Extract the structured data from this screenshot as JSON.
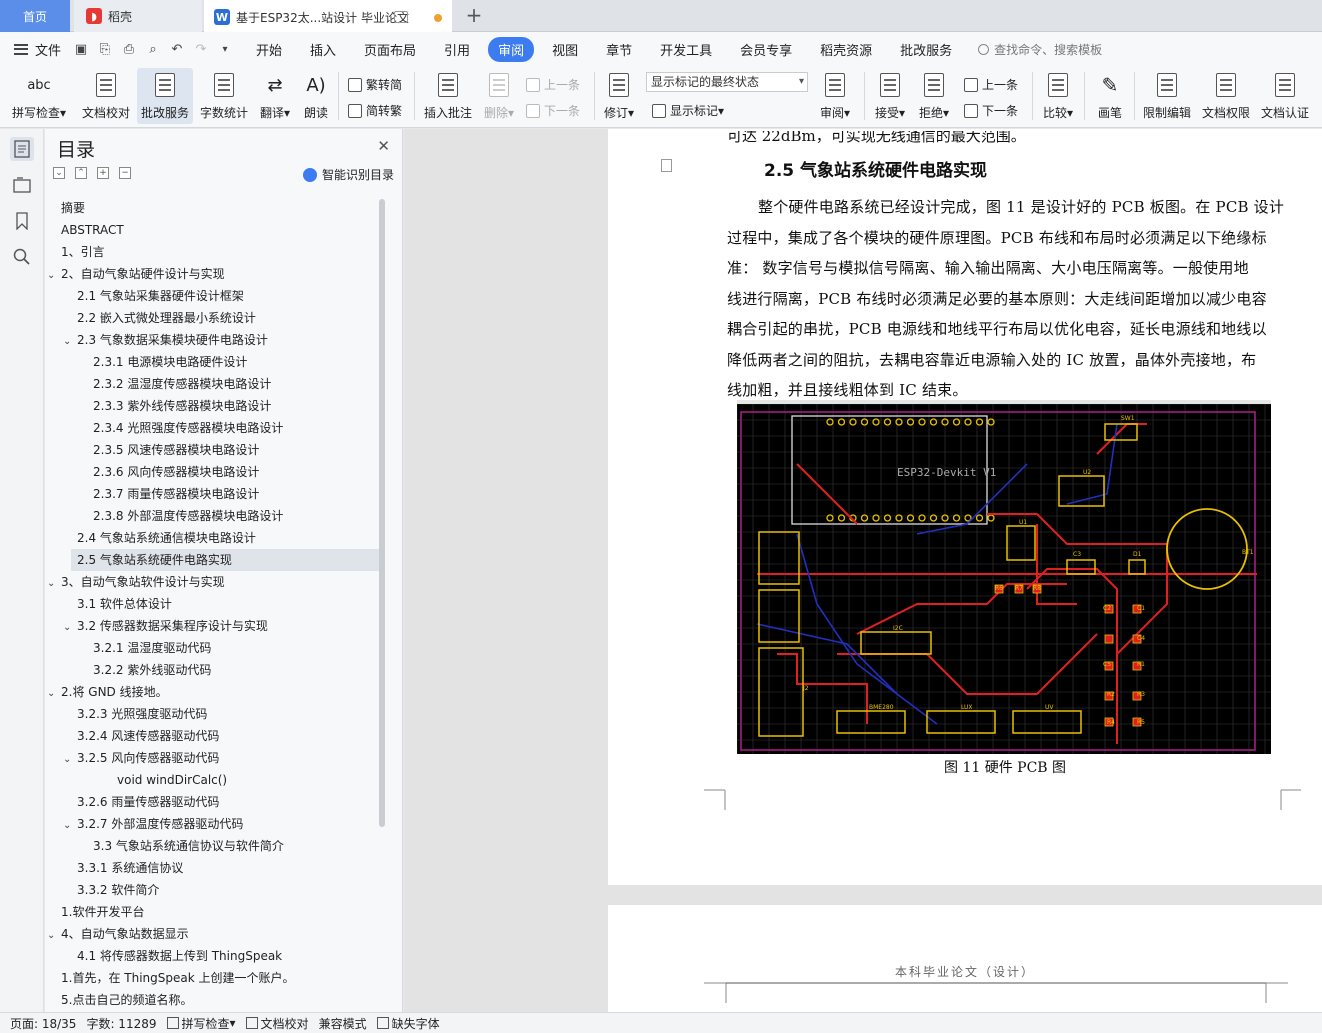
{
  "tabs": {
    "home": "首页",
    "daoke": "稻壳",
    "doc": "基于ESP32太...站设计 毕业论文"
  },
  "menu": {
    "file": "文件",
    "items": [
      "开始",
      "插入",
      "页面布局",
      "引用",
      "审阅",
      "视图",
      "章节",
      "开发工具",
      "会员专享",
      "稻壳资源",
      "批改服务"
    ],
    "active": "审阅",
    "search": "查找命令、搜索模板"
  },
  "ribbon": {
    "spell": "拼写检查",
    "proof": "文档校对",
    "review_service": "批改服务",
    "wordcount": "字数统计",
    "translate": "翻译",
    "read": "朗读",
    "trad": "繁转简",
    "simp": "简转繁",
    "insert_comment": "插入批注",
    "delete": "删除",
    "prev": "上一条",
    "next": "下一条",
    "revise": "修订",
    "markup_state": "显示标记的最终状态",
    "show_markup": "显示标记",
    "review": "审阅",
    "accept": "接受",
    "reject": "拒绝",
    "prev2": "上一条",
    "next2": "下一条",
    "compare": "比较",
    "pen": "画笔",
    "restrict": "限制编辑",
    "perm": "文档权限",
    "cert": "文档认证"
  },
  "toc": {
    "title": "目录",
    "smart": "智能识别目录",
    "items": [
      {
        "label": "摘要",
        "level": 1,
        "caret": ""
      },
      {
        "label": "ABSTRACT",
        "level": 1,
        "caret": ""
      },
      {
        "label": "1、引言",
        "level": 1,
        "caret": ""
      },
      {
        "label": "2、自动气象站硬件设计与实现",
        "level": 1,
        "caret": "v"
      },
      {
        "label": "2.1 气象站采集器硬件设计框架",
        "level": 2,
        "caret": ""
      },
      {
        "label": "2.2 嵌入式微处理器最小系统设计",
        "level": 2,
        "caret": ""
      },
      {
        "label": "2.3  气象数据采集模块硬件电路设计",
        "level": 2,
        "caret": "v"
      },
      {
        "label": "2.3.1 电源模块电路硬件设计",
        "level": 3,
        "caret": ""
      },
      {
        "label": "2.3.2 温湿度传感器模块电路设计",
        "level": 3,
        "caret": ""
      },
      {
        "label": "2.3.3 紫外线传感器模块电路设计",
        "level": 3,
        "caret": ""
      },
      {
        "label": "2.3.4 光照强度传感器模块电路设计",
        "level": 3,
        "caret": ""
      },
      {
        "label": "2.3.5 风速传感器模块电路设计",
        "level": 3,
        "caret": ""
      },
      {
        "label": "2.3.6 风向传感器模块电路设计",
        "level": 3,
        "caret": ""
      },
      {
        "label": "2.3.7 雨量传感器模块电路设计",
        "level": 3,
        "caret": ""
      },
      {
        "label": "2.3.8 外部温度传感器模块电路设计",
        "level": 3,
        "caret": ""
      },
      {
        "label": "2.4 气象站系统通信模块电路设计",
        "level": 2,
        "caret": ""
      },
      {
        "label": "2.5 气象站系统硬件电路实现",
        "level": 2,
        "caret": "",
        "selected": true
      },
      {
        "label": "3、自动气象站软件设计与实现",
        "level": 1,
        "caret": "v"
      },
      {
        "label": "3.1 软件总体设计",
        "level": 2,
        "caret": ""
      },
      {
        "label": "3.2 传感器数据采集程序设计与实现",
        "level": 2,
        "caret": "v"
      },
      {
        "label": "3.2.1 温湿度驱动代码",
        "level": 3,
        "caret": ""
      },
      {
        "label": "3.2.2 紫外线驱动代码",
        "level": 3,
        "caret": ""
      },
      {
        "label": "2.将 GND 线接地。",
        "level": 1,
        "caret": "v"
      },
      {
        "label": "3.2.3 光照强度驱动代码",
        "level": 2,
        "caret": ""
      },
      {
        "label": "3.2.4 风速传感器驱动代码",
        "level": 2,
        "caret": ""
      },
      {
        "label": "3.2.5 风向传感器驱动代码",
        "level": 2,
        "caret": "v"
      },
      {
        "label": "void windDirCalc()",
        "level": 4,
        "caret": ""
      },
      {
        "label": "3.2.6 雨量传感器驱动代码",
        "level": 2,
        "caret": ""
      },
      {
        "label": "3.2.7 外部温度传感器驱动代码",
        "level": 2,
        "caret": "v"
      },
      {
        "label": "3.3 气象站系统通信协议与软件简介",
        "level": 3,
        "caret": ""
      },
      {
        "label": "3.3.1 系统通信协议",
        "level": 2,
        "caret": ""
      },
      {
        "label": "3.3.2 软件简介",
        "level": 2,
        "caret": ""
      },
      {
        "label": "1.软件开发平台",
        "level": 1,
        "caret": ""
      },
      {
        "label": "4、自动气象站数据显示",
        "level": 1,
        "caret": "v"
      },
      {
        "label": "4.1 将传感器数据上传到 ThingSpeak",
        "level": 2,
        "caret": ""
      },
      {
        "label": "1.首先，在 ThingSpeak 上创建一个账户。",
        "level": 1,
        "caret": ""
      },
      {
        "label": "5.点击自己的频道名称。",
        "level": 1,
        "caret": ""
      }
    ]
  },
  "doc": {
    "top_partial": "可达 22dBm，可实现无线通信的最大范围。",
    "heading": "2.5 气象站系统硬件电路实现",
    "paragraph": [
      "整个硬件电路系统已经设计完成，图 11 是设计好的 PCB 板图。在 PCB 设计",
      "过程中，集成了各个模块的硬件原理图。PCB 布线和布局时必须满足以下绝缘标",
      "准：  数字信号与模拟信号隔离、输入输出隔离、大小电压隔离等。一般使用地",
      "线进行隔离，PCB 布线时必须满足必要的基本原则：大走线间距增加以减少电容",
      "耦合引起的串扰，PCB 电源线和地线平行布局以优化电容，延长电源线和地线以",
      "降低两者之间的阻抗，去耦电容靠近电源输入处的 IC 放置，晶体外壳接地，布",
      "线加粗，并且接线粗体到 IC 结束。"
    ],
    "pcb": {
      "esp_label": "ESP32-Devkit V1",
      "labels": [
        "U2",
        "U1",
        "C3",
        "D1",
        "SW1",
        "R6",
        "R7",
        "R8",
        "C1",
        "C2",
        "C4",
        "C5",
        "R1",
        "R2",
        "R3",
        "R4",
        "R5",
        "I2C",
        "BME280",
        "LUX",
        "UV",
        "J2",
        "BT1"
      ]
    },
    "figure_caption": "图 11 硬件 PCB 图",
    "page2_header": "本科毕业论文（设计）"
  },
  "status": {
    "page": "页面: 18/35",
    "words": "字数: 11289",
    "spell": "拼写检查",
    "proof": "文档校对",
    "compat": "兼容模式",
    "missing_font": "缺失字体"
  },
  "colors": {
    "accent": "#3c7cf0",
    "home_tab": "#5b8ee8",
    "pcb_red": "#e02020",
    "pcb_yellow": "#e8c000",
    "pcb_blue": "#2030c0"
  }
}
